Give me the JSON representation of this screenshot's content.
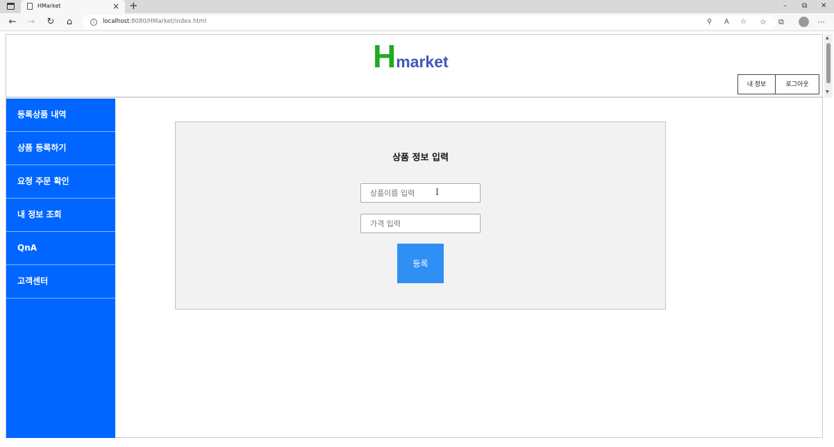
{
  "browser": {
    "tab_title": "HMarket",
    "tab_close": "×",
    "new_tab": "+",
    "url_host": "localhost",
    "url_path": ":8080/HMarket/index.html",
    "controls": {
      "minimize": "–",
      "restore": "⧉",
      "close": "✕"
    },
    "icons": [
      "back-icon",
      "forward-icon",
      "refresh-icon",
      "home-icon",
      "info-icon",
      "search-key-icon",
      "read-aloud-icon",
      "add-favorite-icon",
      "favorites-icon",
      "collections-icon",
      "profile-icon",
      "more-icon"
    ]
  },
  "header": {
    "logo_h": "H",
    "logo_rest": "market",
    "my_info_button": "내 정보",
    "logout_button": "로그아웃"
  },
  "sidebar": {
    "items": [
      {
        "label": "등록상품 내역"
      },
      {
        "label": "상품 등록하기"
      },
      {
        "label": "요청 주문 확인"
      },
      {
        "label": "내 정보 조회"
      },
      {
        "label": "QnA"
      },
      {
        "label": "고객센터"
      }
    ]
  },
  "form": {
    "title": "상품 정보 입력",
    "name_placeholder": "상품이름 입력",
    "price_placeholder": "가격 입력",
    "submit_label": "등록"
  },
  "colors": {
    "sidebar": "#0066ff",
    "submit_button": "#2f8ff5",
    "logo_h": "#22aa22",
    "logo_text": "#4455bb",
    "form_panel": "#f2f2f2"
  }
}
